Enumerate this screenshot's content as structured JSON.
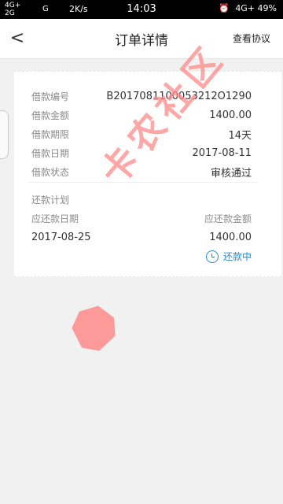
{
  "status_bar": {
    "left_top": "4G+",
    "left_bottom": "2G",
    "network": "G",
    "speed": "2K/s",
    "time": "14:03",
    "right": "4G+ 49%",
    "icons": [
      "signal-icon",
      "alarm-icon",
      "battery-icon"
    ]
  },
  "header": {
    "back_icon": "<",
    "title": "订单详情",
    "protocol_link": "查看协议"
  },
  "card": {
    "rows": [
      {
        "label": "借款编号",
        "value": "B2017081100053212O1290"
      },
      {
        "label": "借款金额",
        "value": "1400.00"
      },
      {
        "label": "借款期限",
        "value": "14天"
      },
      {
        "label": "借款日期",
        "value": "2017-08-11"
      },
      {
        "label": "借款状态",
        "value": "审核通过"
      }
    ],
    "repayment_plan_label": "还款计划",
    "table_header": {
      "date_label": "应还款日期",
      "amount_label": "应还款金额"
    },
    "repayment_row": {
      "date": "2017-08-25",
      "amount": "1400.00"
    },
    "repayment_status": "还款中"
  },
  "watermark": {
    "text": "卡农社区"
  },
  "colors": {
    "accent": "#2f86d6",
    "watermark": "#ff8a8a"
  }
}
